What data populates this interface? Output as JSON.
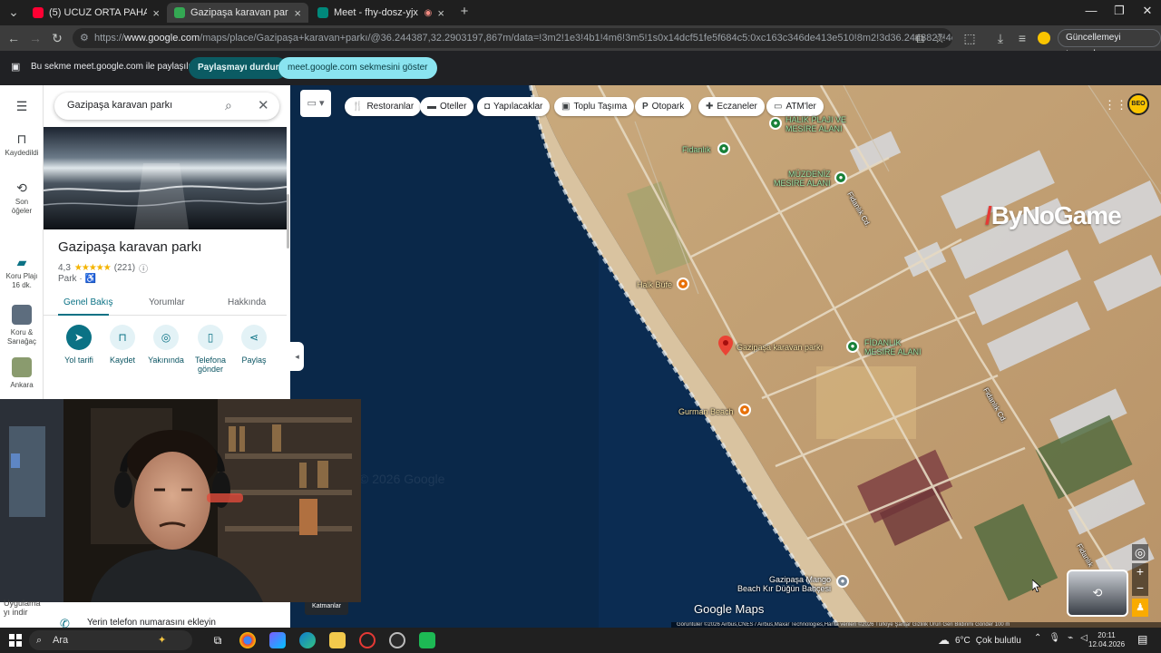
{
  "browser": {
    "tabs": [
      {
        "title": "(5) UCUZ ORTA PAHALI VE ULTR",
        "favicon_color": "#ff0033"
      },
      {
        "title": "Gazipaşa karavan parkı - Go",
        "favicon_color": "#34a853"
      },
      {
        "title": "Meet - fhy-dosz-yjx",
        "favicon_color": "#00897b"
      }
    ],
    "new_tab": "+",
    "url_prefix": "https://",
    "url_host": "www.google.com",
    "url_path": "/maps/place/Gazipaşa+karavan+parkı/@36.244387,32.2903197,867m/data=!3m2!1e3!4b1!4m6!3m5!1s0x14dcf51fe5f684c5:0xc163c346de413e510!8m2!3d36.2443827!4d32.2928946!16s%2Fg...",
    "update_button": "Güncellemeyi tamamla"
  },
  "sharebar": {
    "message": "Bu sekme meet.google.com ile paylaşılıyor",
    "stop_button": "Paylaşmayı durdur",
    "show_button": "meet.google.com sekmesini göster"
  },
  "rail": {
    "saved": "Kaydedildi",
    "recent_1": "Son",
    "recent_2": "öğeler",
    "item1_l1": "Koru Plajı",
    "item1_l2": "16 dk.",
    "item2_l1": "Koru &",
    "item2_l2": "Sarıağaç",
    "item3_l1": "Ankara"
  },
  "panel": {
    "search_query": "Gazipaşa karavan parkı",
    "place_name": "Gazipaşa karavan parkı",
    "rating": "4,3",
    "stars": "★★★★★",
    "review_count": "(221)",
    "category": "Park ·",
    "tabs": [
      "Genel Bakış",
      "Yorumlar",
      "Hakkında"
    ],
    "actions": [
      {
        "l1": "Yol tarifi",
        "l2": ""
      },
      {
        "l1": "Kaydet",
        "l2": ""
      },
      {
        "l1": "Yakınında",
        "l2": ""
      },
      {
        "l1": "Telefona",
        "l2": "gönder"
      },
      {
        "l1": "Paylaş",
        "l2": ""
      }
    ],
    "lower_1": "Uygulama",
    "lower_2": "yı indir",
    "phone_prompt": "Yerin telefon numarasını ekleyin"
  },
  "chips": [
    "Restoranlar",
    "Oteller",
    "Yapılacaklar",
    "Toplu Taşıma",
    "Otopark",
    "Eczaneler",
    "ATM'ler"
  ],
  "map_labels": {
    "halik_plaji_1": "HALIK PLAJI VE",
    "halik_plaji_2": "MESİRE ALANI",
    "fidanlik": "Fidanlık",
    "muz_1": "MÜZDENİZ",
    "muz_2": "MESİRE ALANI",
    "fidanlik_cd": "Fidanlık Cd.",
    "halk_bufe": "Halk Büfe",
    "place": "Gazipaşa karavan parkı",
    "fidanlik_mesire_1": "FİDANLIK",
    "fidanlik_mesire_2": "MESİRE ALANI",
    "gurman": "Gurman Beach",
    "mango_1": "Gazipaşa Mango",
    "mango_2": "Beach Kır Düğün Bahçesi",
    "fidanlik_cd_2": "Fidanlık Cd.",
    "fidanlik_cd_3": "Fidanlık"
  },
  "overlay": {
    "logo": "ByNoGame",
    "badge": "BEO",
    "watermark": "© 2026 Google",
    "layers_label": "Katmanlar",
    "google_maps": "Google Maps",
    "attribution": "Görüntüler ©2026 Airbus,CNES / Airbus,Maxar Technologies,Harita verileri ©2026    Türkiye    Şartlar    Gizlilik    Ürün Geri Bildirimi Gönder    100 m"
  },
  "taskbar": {
    "search": "Ara",
    "weather_temp": "6°C",
    "weather_text": "Çok bulutlu",
    "time": "20:11",
    "date": "12.04.2026"
  },
  "colors": {
    "accent": "#0b7285",
    "sea": "#0a2a4d",
    "share_stop": "#0b5b63",
    "share_show": "#8ae4f0"
  }
}
